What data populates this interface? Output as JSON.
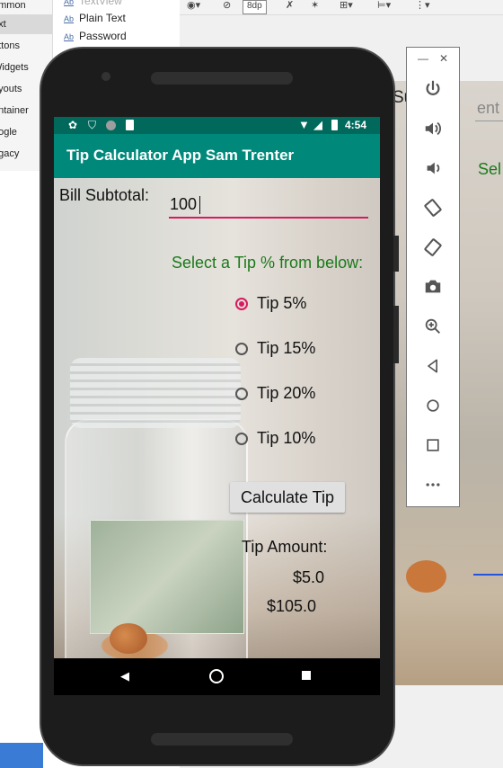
{
  "studio": {
    "palette_categories": [
      "ommon",
      "ext",
      "uttons",
      "Widgets",
      "ayouts",
      "ontainer",
      "oogle",
      "egacy"
    ],
    "palette_selected_index": 1,
    "widgets": [
      {
        "icon": "Ab",
        "label": "TextView"
      },
      {
        "icon": "Ab",
        "label": "Plain Text"
      },
      {
        "icon": "Ab",
        "label": "Password"
      }
    ],
    "toolbar": {
      "margin_value": "8dp"
    },
    "blueprint": {
      "label_fragment": "Su",
      "hint_fragment": "ent",
      "select_fragment": "Sel"
    }
  },
  "status_bar": {
    "time": "4:54"
  },
  "app": {
    "title": "Tip Calculator App Sam Trenter",
    "subtotal_label": "Bill Subtotal:",
    "subtotal_value": "100",
    "tip_prompt": "Select a Tip % from below:",
    "tip_options": [
      {
        "label": "Tip 5%",
        "selected": true
      },
      {
        "label": "Tip 15%",
        "selected": false
      },
      {
        "label": "Tip 20%",
        "selected": false
      },
      {
        "label": "Tip 10%",
        "selected": false
      }
    ],
    "calculate_button": "Calculate Tip",
    "tip_amount_label": "Tip Amount:",
    "tip_amount_value": "$5.0",
    "total_value": "$105.0"
  },
  "colors": {
    "status_bar": "#00695c",
    "app_bar": "#00897b",
    "accent": "#d81b60",
    "prompt_text": "#1b7a1b"
  },
  "emulator_controls": {
    "window_buttons": [
      "minimize-icon",
      "close-icon"
    ],
    "tools": [
      "power-icon",
      "volume-up-icon",
      "volume-down-icon",
      "rotate-left-icon",
      "rotate-right-icon",
      "camera-icon",
      "zoom-icon",
      "back-icon",
      "home-icon",
      "overview-icon",
      "more-icon"
    ]
  }
}
